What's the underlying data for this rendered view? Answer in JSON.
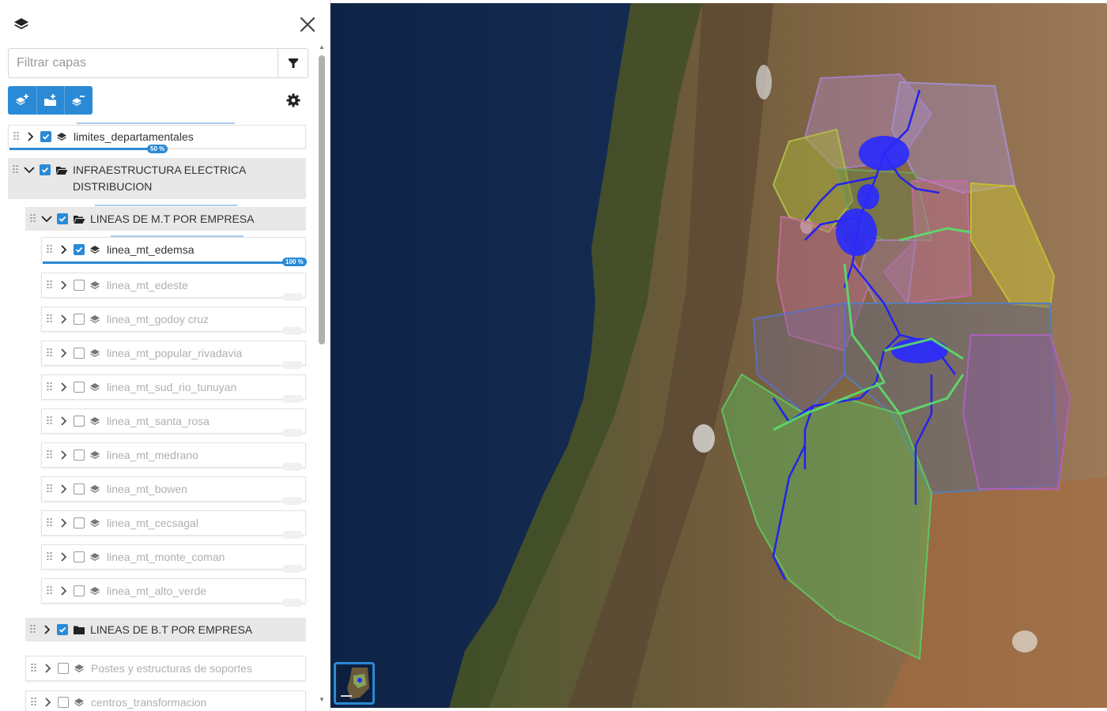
{
  "panel": {
    "filter": {
      "placeholder": "Filtrar capas",
      "value": ""
    }
  },
  "tree": {
    "limites": {
      "label": "limites_departamentales",
      "checked": true,
      "progress_label": "50 %"
    },
    "infra": {
      "label": "INFRAESTRUCTURA ELECTRICA DISTRIBUCION",
      "checked": true
    },
    "mt_group": {
      "label": "LINEAS DE M.T POR EMPRESA",
      "checked": true
    },
    "mt_layers": [
      {
        "label": "linea_mt_edemsa",
        "checked": true,
        "progress_label": "100 %"
      },
      {
        "label": "linea_mt_edeste",
        "checked": false
      },
      {
        "label": "linea_mt_godoy cruz",
        "checked": false
      },
      {
        "label": "linea_mt_popular_rivadavia",
        "checked": false
      },
      {
        "label": "linea_mt_sud_rio_tunuyan",
        "checked": false
      },
      {
        "label": "linea_mt_santa_rosa",
        "checked": false
      },
      {
        "label": "linea_mt_medrano",
        "checked": false
      },
      {
        "label": "linea_mt_bowen",
        "checked": false
      },
      {
        "label": "linea_mt_cecsagal",
        "checked": false
      },
      {
        "label": "linea_mt_monte_coman",
        "checked": false
      },
      {
        "label": "linea_mt_alto_verde",
        "checked": false
      }
    ],
    "bt_group": {
      "label": "LINEAS DE B.T POR EMPRESA",
      "checked": true
    },
    "postes": {
      "label": "Postes y estructuras de soportes",
      "checked": false
    },
    "centros": {
      "label": "centros_transformacion",
      "checked": false
    }
  },
  "icons": {
    "logo": "layers-icon",
    "close": "close-icon",
    "filter": "funnel-icon",
    "tools": [
      "add-layer-icon",
      "add-folder-icon",
      "remove-layer-icon"
    ],
    "settings": "gear-icon"
  },
  "colors": {
    "accent": "#2a8ad6",
    "ocean": "#142c52",
    "mt_lines": "#2222ee",
    "route_lines": "#5adf6a"
  }
}
